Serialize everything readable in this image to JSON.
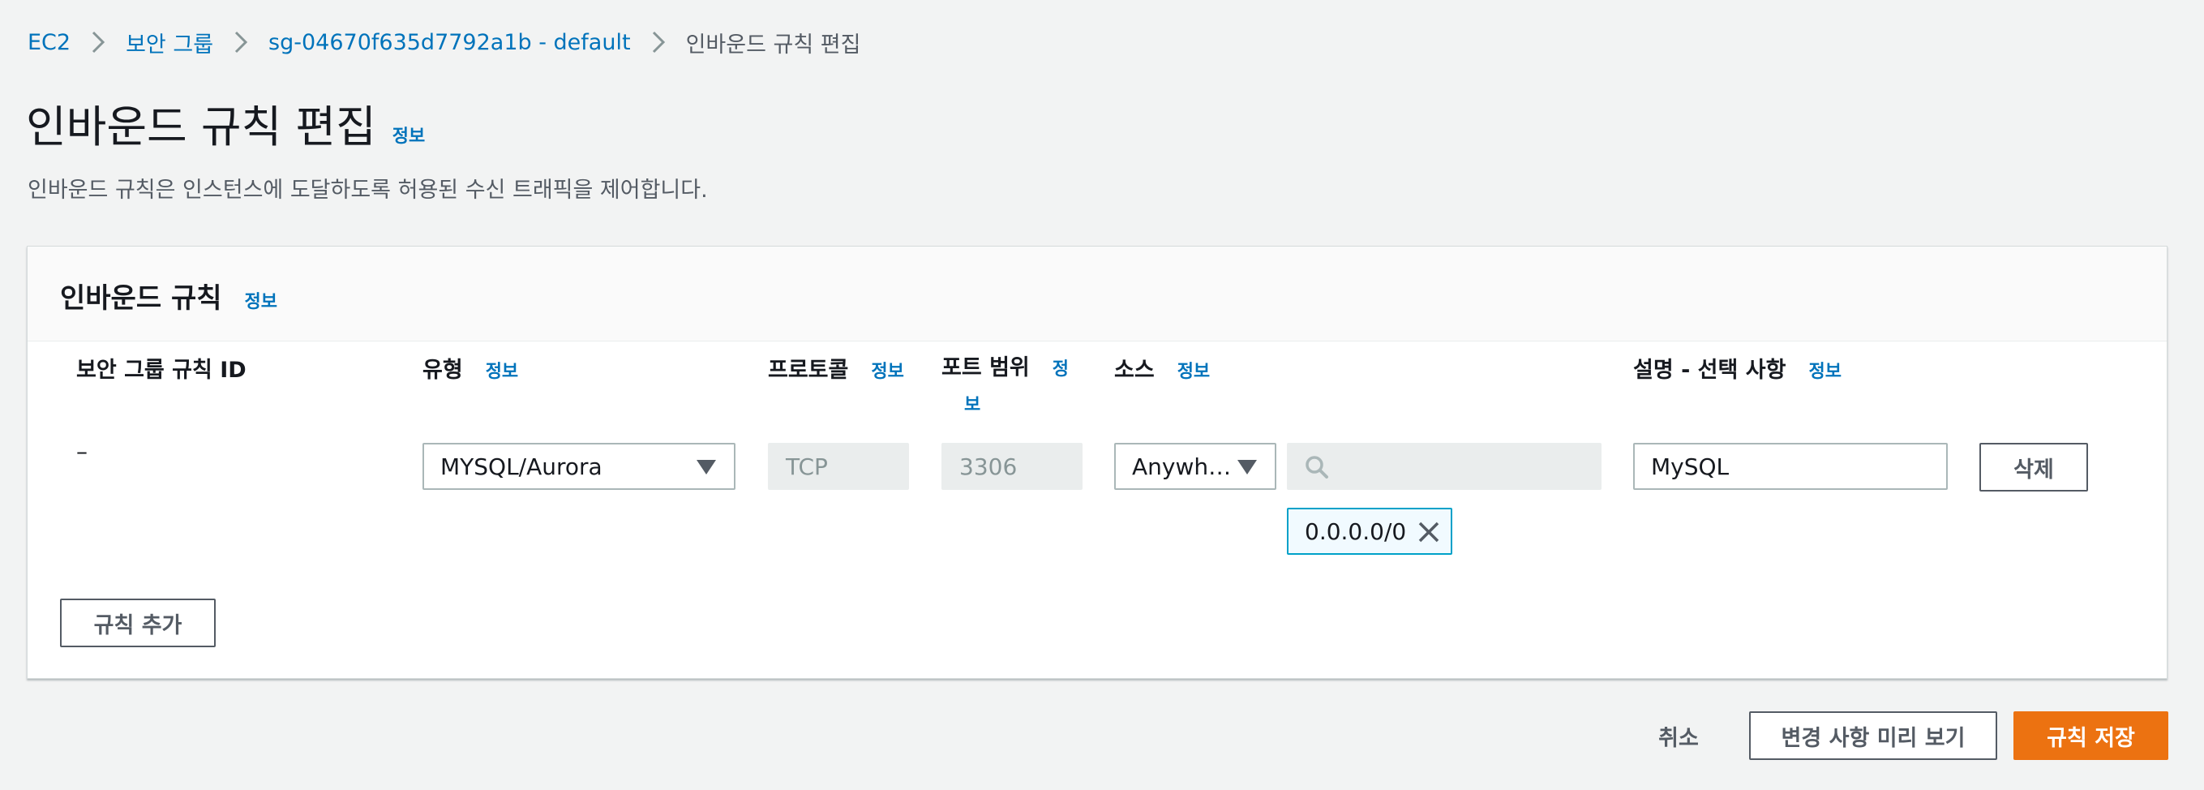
{
  "breadcrumb": {
    "items": [
      "EC2",
      "보안 그룹",
      "sg-04670f635d7792a1b - default"
    ],
    "current": "인바운드 규칙 편집"
  },
  "header": {
    "title": "인바운드 규칙 편집",
    "info": "정보",
    "description": "인바운드 규칙은 인스턴스에 도달하도록 허용된 수신 트래픽을 제어합니다."
  },
  "panel": {
    "title": "인바운드 규칙",
    "info": "정보",
    "columns": {
      "rule_id": "보안 그룹 규칙 ID",
      "type": "유형",
      "protocol": "프로토콜",
      "port_range_line1": "포트 범위",
      "port_range_info_1": "정",
      "port_range_info_2": "보",
      "source": "소스",
      "description": "설명 - 선택 사항",
      "info": "정보"
    },
    "rule": {
      "rule_id": "–",
      "type": "MYSQL/Aurora",
      "protocol": "TCP",
      "port_range": "3306",
      "source_select": "Anywh…",
      "source_search_placeholder": "",
      "source_token": "0.0.0.0/0",
      "description": "MySQL",
      "delete_label": "삭제"
    },
    "add_rule_label": "규칙 추가"
  },
  "footer": {
    "cancel_label": "취소",
    "preview_label": "변경 사항 미리 보기",
    "save_label": "규칙 저장"
  }
}
